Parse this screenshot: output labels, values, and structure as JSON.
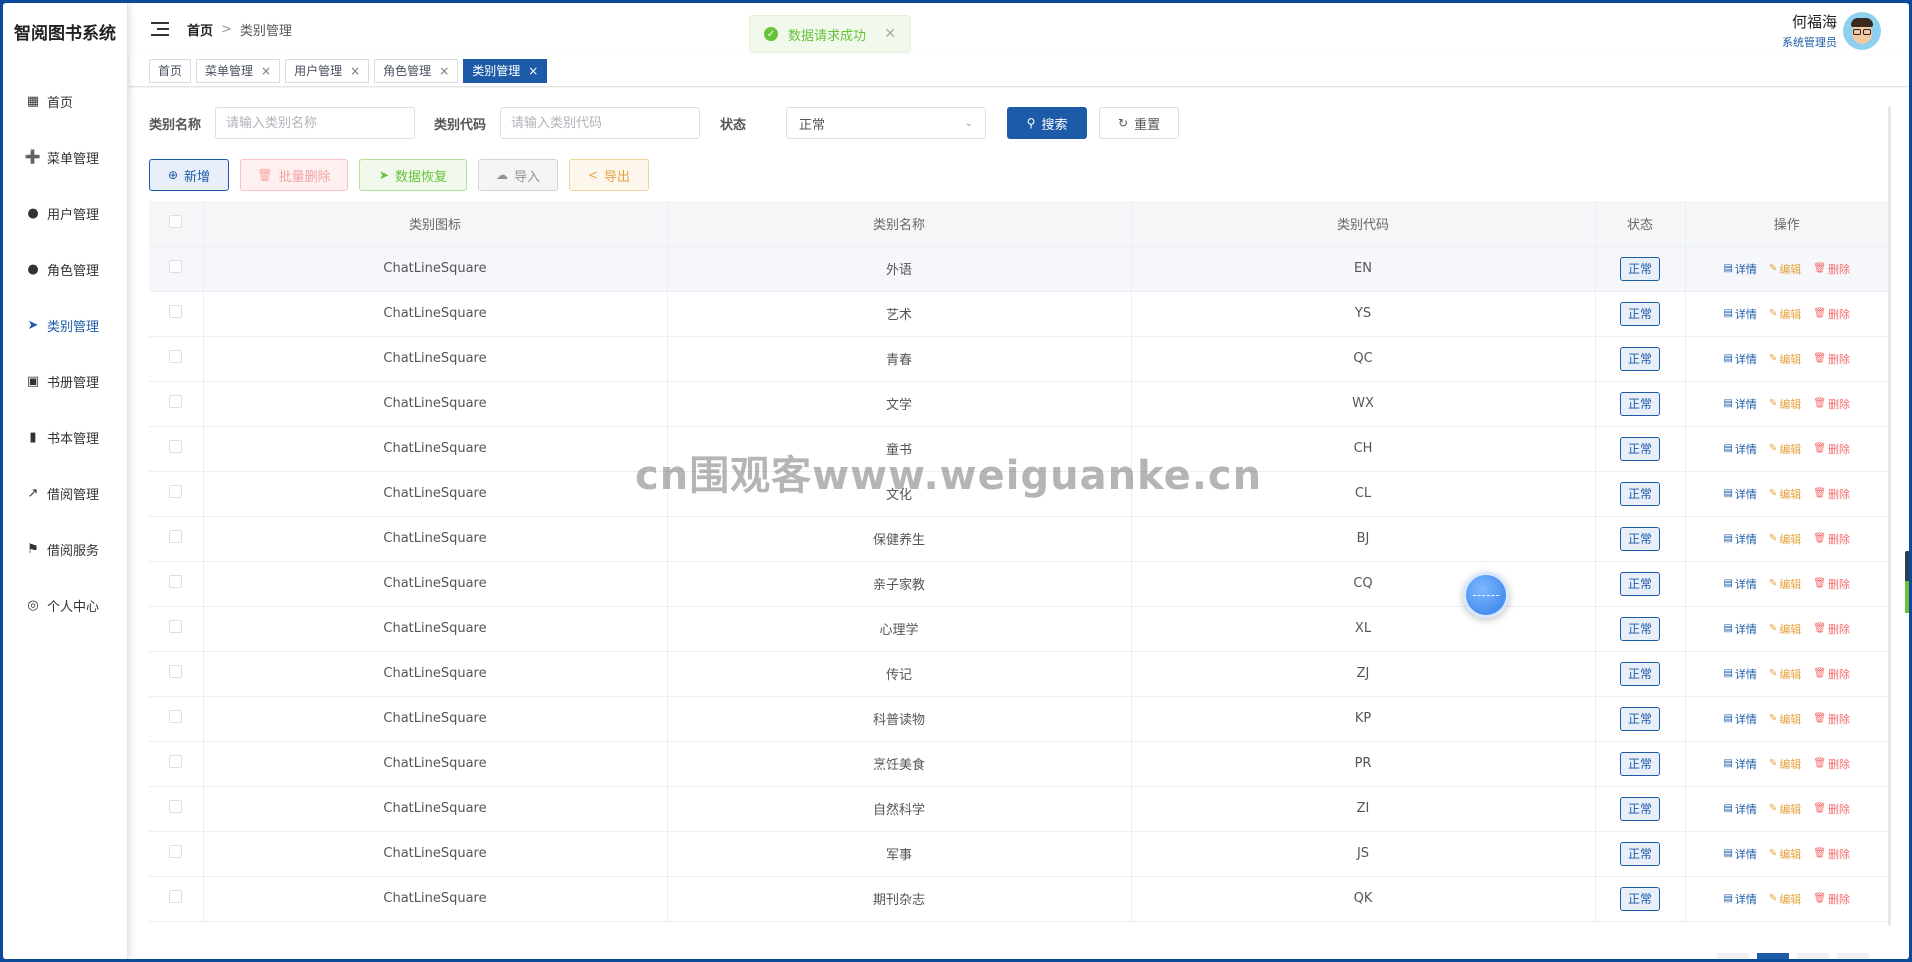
{
  "app": {
    "title": "智阅图书系统"
  },
  "sidebar": {
    "items": [
      {
        "label": "首页",
        "icon": "grid-icon"
      },
      {
        "label": "菜单管理",
        "icon": "menu-icon"
      },
      {
        "label": "用户管理",
        "icon": "user-icon"
      },
      {
        "label": "角色管理",
        "icon": "role-icon"
      },
      {
        "label": "类别管理",
        "icon": "paper-plane-icon",
        "active": true
      },
      {
        "label": "书册管理",
        "icon": "monitor-icon"
      },
      {
        "label": "书本管理",
        "icon": "books-icon"
      },
      {
        "label": "借阅管理",
        "icon": "chart-icon"
      },
      {
        "label": "借阅服务",
        "icon": "flag-icon"
      },
      {
        "label": "个人中心",
        "icon": "location-icon"
      }
    ]
  },
  "header": {
    "breadcrumb_home": "首页",
    "breadcrumb_sep": ">",
    "breadcrumb_current": "类别管理",
    "toast": {
      "text": "数据请求成功",
      "close": "✕"
    },
    "user": {
      "name": "何福海",
      "role": "系统管理员"
    }
  },
  "tabs": [
    {
      "label": "首页",
      "closable": false
    },
    {
      "label": "菜单管理",
      "closable": true
    },
    {
      "label": "用户管理",
      "closable": true
    },
    {
      "label": "角色管理",
      "closable": true
    },
    {
      "label": "类别管理",
      "closable": true,
      "active": true
    }
  ],
  "search": {
    "name_label": "类别名称",
    "name_placeholder": "请输入类别名称",
    "code_label": "类别代码",
    "code_placeholder": "请输入类别代码",
    "status_label": "状态",
    "status_value": "正常",
    "search_btn": "搜索",
    "reset_btn": "重置"
  },
  "actions": {
    "add": "新增",
    "batch_delete": "批量删除",
    "restore": "数据恢复",
    "import": "导入",
    "export": "导出"
  },
  "table": {
    "headers": [
      "类别图标",
      "类别名称",
      "类别代码",
      "状态",
      "操作"
    ],
    "op_labels": {
      "detail": "详情",
      "edit": "编辑",
      "delete": "删除"
    },
    "rows": [
      {
        "icon": "ChatLineSquare",
        "name": "外语",
        "code": "EN",
        "status": "正常"
      },
      {
        "icon": "ChatLineSquare",
        "name": "艺术",
        "code": "YS",
        "status": "正常"
      },
      {
        "icon": "ChatLineSquare",
        "name": "青春",
        "code": "QC",
        "status": "正常"
      },
      {
        "icon": "ChatLineSquare",
        "name": "文学",
        "code": "WX",
        "status": "正常"
      },
      {
        "icon": "ChatLineSquare",
        "name": "童书",
        "code": "CH",
        "status": "正常"
      },
      {
        "icon": "ChatLineSquare",
        "name": "文化",
        "code": "CL",
        "status": "正常"
      },
      {
        "icon": "ChatLineSquare",
        "name": "保健养生",
        "code": "BJ",
        "status": "正常"
      },
      {
        "icon": "ChatLineSquare",
        "name": "亲子家教",
        "code": "CQ",
        "status": "正常"
      },
      {
        "icon": "ChatLineSquare",
        "name": "心理学",
        "code": "XL",
        "status": "正常"
      },
      {
        "icon": "ChatLineSquare",
        "name": "传记",
        "code": "ZJ",
        "status": "正常"
      },
      {
        "icon": "ChatLineSquare",
        "name": "科普读物",
        "code": "KP",
        "status": "正常"
      },
      {
        "icon": "ChatLineSquare",
        "name": "烹饪美食",
        "code": "PR",
        "status": "正常"
      },
      {
        "icon": "ChatLineSquare",
        "name": "自然科学",
        "code": "ZI",
        "status": "正常"
      },
      {
        "icon": "ChatLineSquare",
        "name": "军事",
        "code": "JS",
        "status": "正常"
      },
      {
        "icon": "ChatLineSquare",
        "name": "期刊杂志",
        "code": "QK",
        "status": "正常"
      }
    ]
  },
  "watermark": "cn围观客www.weiguanke.cn",
  "colors": {
    "primary": "#1d5ba8",
    "success": "#67c23a",
    "warning": "#e6a23c",
    "danger": "#f56c6c",
    "frame": "#0d4a9a"
  }
}
